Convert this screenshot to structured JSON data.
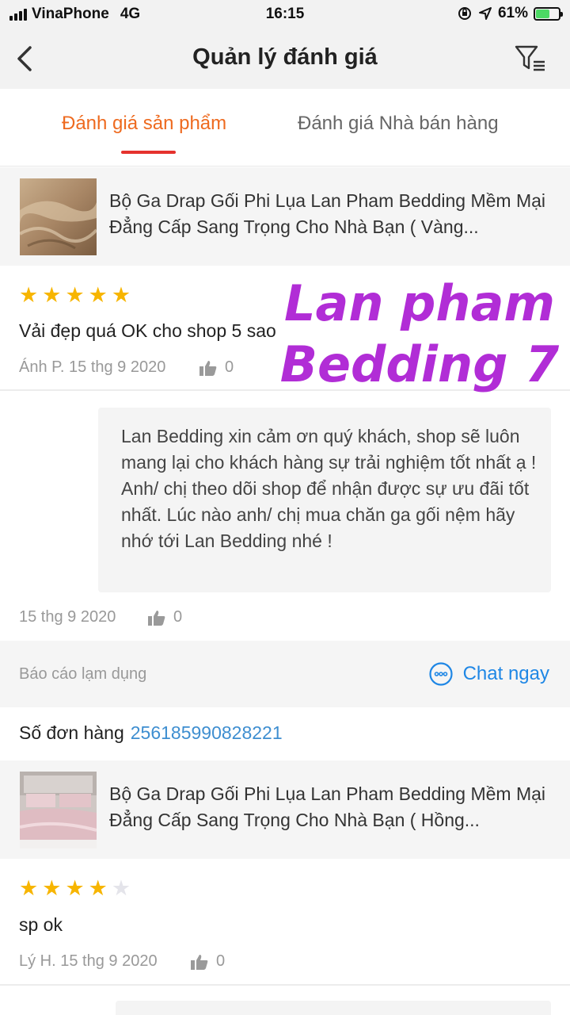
{
  "status_bar": {
    "carrier": "VinaPhone",
    "network": "4G",
    "time": "16:15",
    "battery": "61%",
    "battery_level": 0.61
  },
  "nav": {
    "title": "Quản lý đánh giá",
    "back_icon": "chevron-left-icon",
    "filter_icon": "filter-icon"
  },
  "tabs": [
    {
      "label": "Đánh giá sản phẩm",
      "active": true
    },
    {
      "label": "Đánh giá Nhà bán hàng",
      "active": false
    }
  ],
  "colors": {
    "accent_orange": "#ee6a1f",
    "tab_underline": "#e5322d",
    "link_blue": "#1f87e5",
    "star": "#f7b500",
    "watermark": "#b12dd6"
  },
  "reviews": [
    {
      "product_name": "Bộ Ga Drap Gối Phi Lụa Lan Pham Bedding Mềm Mại Đẳng Cấp Sang Trọng Cho Nhà Bạn ( Vàng...",
      "rating": 5,
      "text": "Vải đẹp quá OK cho shop 5 sao",
      "author_date": "Ánh P. 15 thg 9 2020",
      "likes": "0",
      "reply": {
        "text": "Lan Bedding xin cảm ơn quý khách, shop sẽ luôn mang lại cho khách hàng sự trải nghiệm tốt nhất ạ ! Anh/ chị theo dõi shop để nhận được sự ưu đãi tốt nhất. Lúc nào anh/ chị mua chăn ga gối nệm hãy nhớ tới Lan Bedding nhé !",
        "date": "15 thg 9 2020",
        "likes": "0"
      },
      "report_label": "Báo cáo lạm dụng",
      "chat_label": "Chat ngay"
    },
    {
      "order_label": "Số đơn hàng",
      "order_number": "256185990828221",
      "product_name": "Bộ Ga Drap Gối Phi Lụa Lan Pham Bedding Mềm Mại Đẳng Cấp Sang Trọng Cho Nhà Bạn ( Hồng...",
      "rating": 4,
      "text": "sp ok",
      "author_date": "Lý H. 15 thg 9 2020",
      "likes": "0"
    }
  ],
  "watermark": {
    "line1": "Lan pham",
    "line2": "Bedding 7"
  }
}
